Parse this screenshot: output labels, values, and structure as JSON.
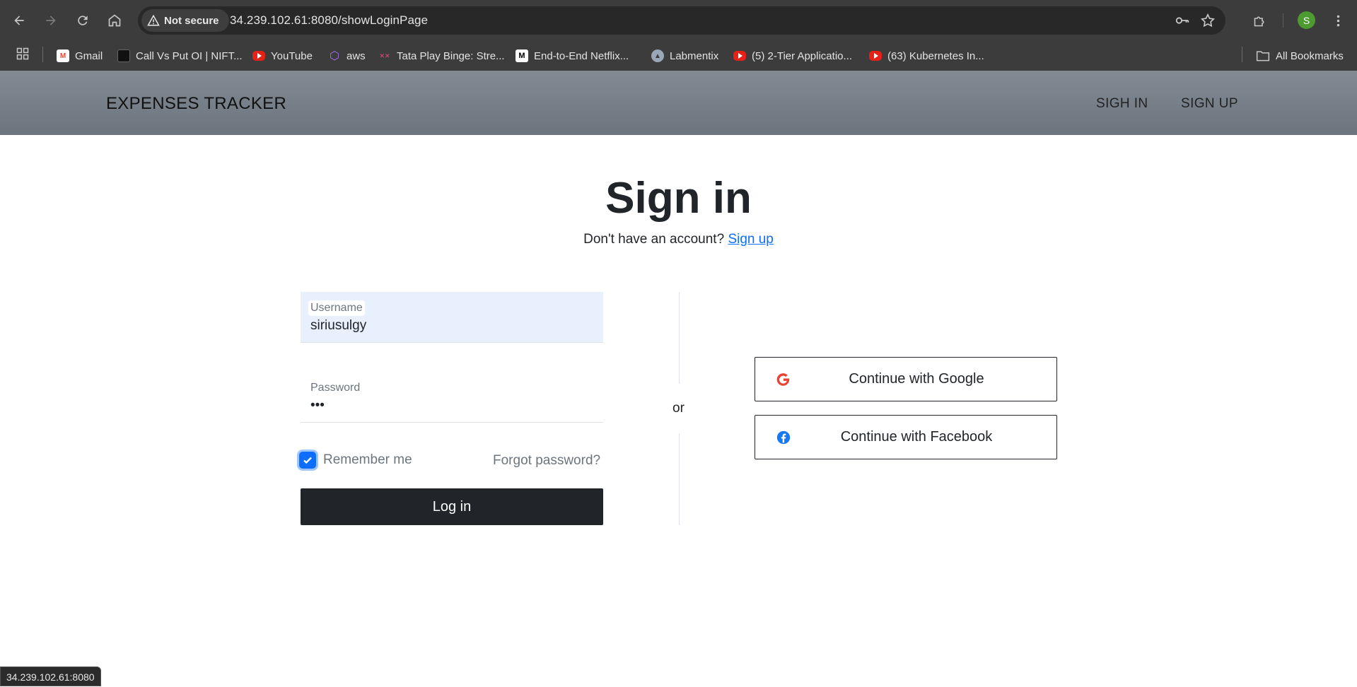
{
  "browser": {
    "security_chip": "Not secure",
    "url": "34.239.102.61:8080/showLoginPage",
    "profile_initial": "S",
    "status_url": "34.239.102.61:8080"
  },
  "bookmarks": {
    "items": [
      {
        "label": "Gmail",
        "icon": "gmail-icon"
      },
      {
        "label": "Call Vs Put OI | NIFT...",
        "icon": "site-icon"
      },
      {
        "label": "YouTube",
        "icon": "youtube-icon"
      },
      {
        "label": "aws",
        "icon": "cube-icon"
      },
      {
        "label": "Tata Play Binge: Stre...",
        "icon": "tata-icon"
      },
      {
        "label": "End-to-End Netflix...",
        "icon": "medium-icon"
      },
      {
        "label": "Labmentix",
        "icon": "labmentix-icon"
      },
      {
        "label": "(5) 2-Tier Applicatio...",
        "icon": "youtube-icon"
      },
      {
        "label": "(63) Kubernetes In...",
        "icon": "youtube-icon"
      }
    ],
    "all_bookmarks": "All Bookmarks"
  },
  "navbar": {
    "brand": "EXPENSES TRACKER",
    "sign_in": "SIGH IN",
    "sign_up": "SIGN UP"
  },
  "login": {
    "title": "Sign in",
    "subtitle_prefix": "Don't have an account?",
    "subtitle_link": "Sign up",
    "username_label": "Username",
    "username_value": "siriusulgy",
    "password_label": "Password",
    "password_value": "•••",
    "remember_label": "Remember me",
    "remember_checked": true,
    "forgot_label": "Forgot password?",
    "login_button": "Log in",
    "divider_text": "or",
    "google_button": "Continue with Google",
    "facebook_button": "Continue with Facebook"
  },
  "colors": {
    "primary": "#0d6efd",
    "dark": "#212529",
    "navbar": "#6c757d",
    "google": "#ea4335",
    "facebook": "#1877f2"
  }
}
